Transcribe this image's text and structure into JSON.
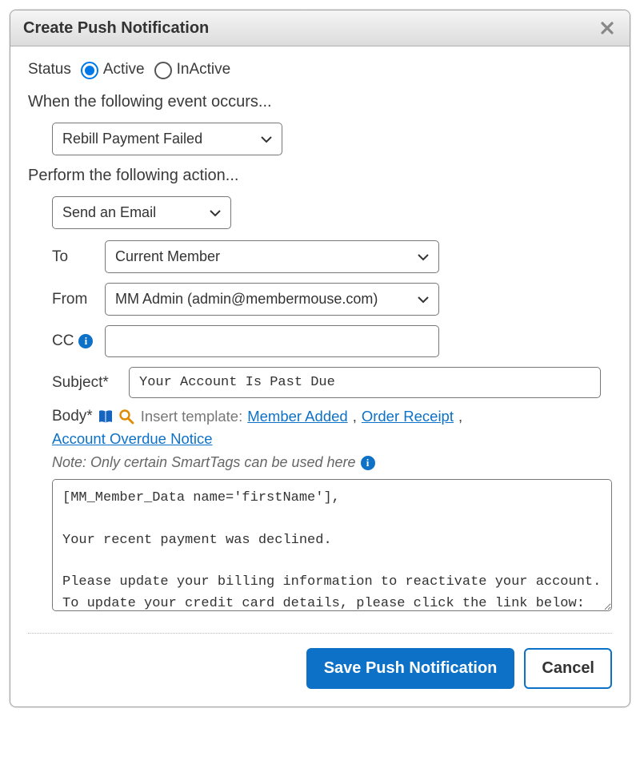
{
  "dialog": {
    "title": "Create Push Notification"
  },
  "status": {
    "label": "Status",
    "active_label": "Active",
    "inactive_label": "InActive",
    "selected": "active"
  },
  "event": {
    "heading": "When the following event occurs...",
    "selected": "Rebill Payment Failed"
  },
  "action": {
    "heading": "Perform the following action...",
    "selected": "Send an Email"
  },
  "email": {
    "to_label": "To",
    "to_value": "Current Member",
    "from_label": "From",
    "from_value": "MM Admin (admin@membermouse.com)",
    "cc_label": "CC",
    "cc_value": "",
    "subject_label": "Subject*",
    "subject_value": "Your Account Is Past Due",
    "body_label": "Body*",
    "insert_template_label": "Insert template:",
    "templates": [
      "Member Added",
      "Order Receipt",
      "Account Overdue Notice"
    ],
    "note": "Note: Only certain SmartTags can be used here",
    "body_value": "[MM_Member_Data name='firstName'],\n\nYour recent payment was declined.\n\nPlease update your billing information to reactivate your account. To update your credit card details, please click the link below:"
  },
  "footer": {
    "save_label": "Save Push Notification",
    "cancel_label": "Cancel"
  }
}
